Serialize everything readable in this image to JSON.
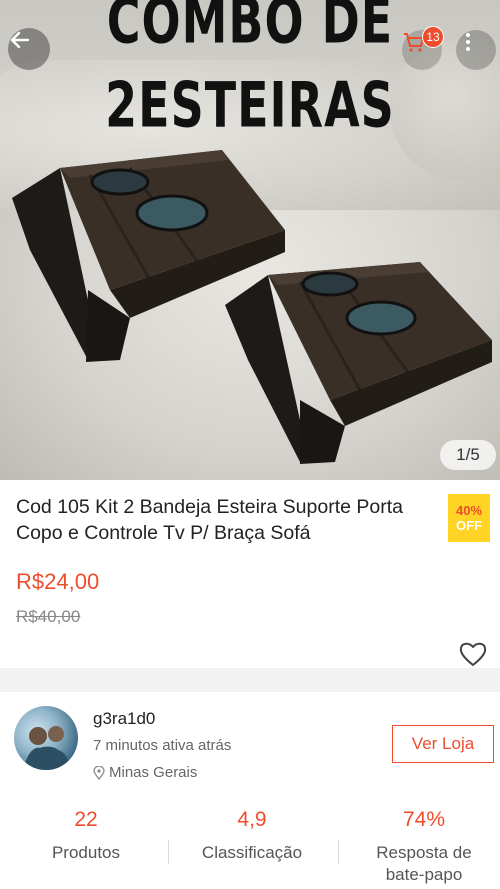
{
  "hero": {
    "headline_line1": "COMBO DE",
    "headline_line2": "2ESTEIRAS",
    "image_counter": "1/5",
    "cart_badge_count": "13"
  },
  "icons": {
    "back": "arrow-left-icon",
    "cart": "cart-icon",
    "more": "more-vertical-icon",
    "favorite": "heart-icon",
    "location": "location-pin-icon"
  },
  "product": {
    "title": "Cod 105 Kit 2 Bandeja Esteira Suporte Porta Copo e Controle Tv P/ Braça Sofá",
    "discount_percent": "40%",
    "discount_off": "OFF",
    "price": "R$24,00",
    "original_price": "R$40,00"
  },
  "seller": {
    "name": "g3ra1d0",
    "active": "7 minutos ativa atrás",
    "location": "Minas Gerais",
    "view_shop_label": "Ver Loja"
  },
  "stats": [
    {
      "value": "22",
      "label": "Produtos"
    },
    {
      "value": "4,9",
      "label": "Classificação"
    },
    {
      "value": "74%",
      "label": "Resposta de bate-papo"
    }
  ],
  "colors": {
    "accent": "#ee4d2d",
    "discount_bg": "#ffd424",
    "divider": "#f2f2f2"
  }
}
